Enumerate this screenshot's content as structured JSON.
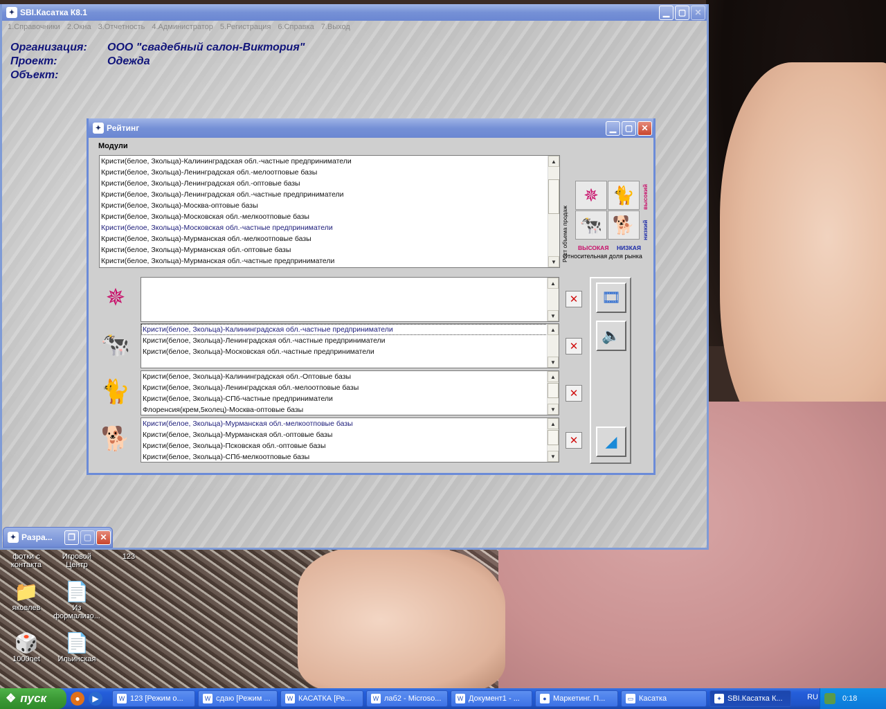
{
  "main_window": {
    "title": "SBI.Касатка К8.1",
    "menu": [
      "1.Справочники",
      "2.Окна",
      "3.Отчетность",
      "4.Администратор",
      "5.Регистрация",
      "6.Справка",
      "7.Выход"
    ],
    "info": [
      {
        "label": "Организация:",
        "value": "ООО \"свадебный салон-Виктория\""
      },
      {
        "label": "Проект:",
        "value": "Одежда"
      },
      {
        "label": "Объект:",
        "value": ""
      }
    ]
  },
  "rating_window": {
    "title": "Рейтинг",
    "modules_label": "Модули",
    "modules": [
      "Кристи(белое, Зкольца)-Калининградская обл.-частные предприниматели",
      "Кристи(белое, Зкольца)-Ленинградская обл.-мелоотповые базы",
      "Кристи(белое, Зкольца)-Ленинградская обл.-оптовые базы",
      "Кристи(белое, Зкольца)-Ленинградская обл.-частные предприниматели",
      "Кристи(белое, Зкольца)-Москва-оптовые базы",
      "Кристи(белое, Зкольца)-Московская обл.-мелкоотповые базы",
      "Кристи(белое, Зкольца)-Московская обл.-частные предприниматели",
      "Кристи(белое, Зкольца)-Мурманская обл.-мелкоотповые базы",
      "Кристи(белое, Зкольца)-Мурманская обл.-оптовые базы",
      "Кристи(белое, Зкольца)-Мурманская обл.-частные предприниматели"
    ],
    "matrix": {
      "y_axis": "Рост объема продаж",
      "x_axis": "Относительная доля рынка",
      "high_label": "высокий",
      "low_label": "низкий",
      "high_share": "высокая",
      "low_share": "низкая"
    },
    "groups": {
      "star": [],
      "cow": [
        "Кристи(белое, Зкольца)-Калининградская обл.-частные предприниматели",
        "Кристи(белое, Зкольца)-Ленинградская обл.-частные предприниматели",
        "Кристи(белое, Зкольца)-Московская обл.-частные предприниматели"
      ],
      "cat": [
        "Кристи(белое, Зкольца)-Калининградская обл.-Оптовые базы",
        "Кристи(белое, Зкольца)-Ленинградская обл.-мелоотповые базы",
        "Кристи(белое, Зкольца)-СПб-частные предприниматели",
        "Флоренсия(крем,5колец)-Москва-оптовые базы"
      ],
      "dog": [
        "Кристи(белое, Зкольца)-Мурманская обл.-мелкоотповые базы",
        "Кристи(белое, Зкольца)-Мурманская обл.-оптовые базы",
        "Кристи(белое, Зкольца)-Псковская обл.-оптовые базы",
        "Кристи(белое, Зкольца)-СПб-мелкоотповые базы"
      ]
    }
  },
  "minimized_window": {
    "title": "Разра..."
  },
  "desktop_icons": [
    {
      "label": "фотки с контакта"
    },
    {
      "label": "Игровой Центр"
    },
    {
      "label": "123"
    },
    {
      "label": "яковлев"
    },
    {
      "label": "Из формализо..."
    },
    {
      "label": "1000net"
    },
    {
      "label": "Ильинская"
    }
  ],
  "taskbar": {
    "start": "пуск",
    "tasks": [
      "123 [Режим о...",
      "сдаю [Режим ...",
      "КАСАТКА [Ре...",
      "лаб2 - Microso...",
      "Документ1 - ...",
      "Маркетинг. П...",
      "Касатка",
      "SBI.Касатка К..."
    ],
    "lang": "RU",
    "clock": "0:18"
  }
}
